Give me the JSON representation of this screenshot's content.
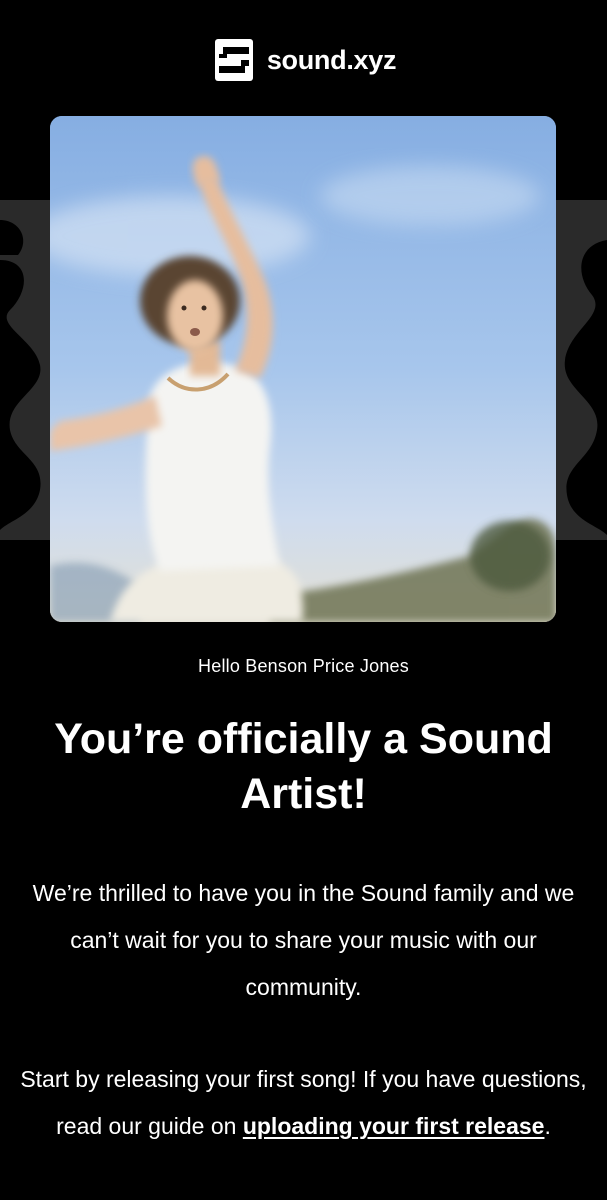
{
  "header": {
    "brand": "sound.xyz",
    "logo_icon": "sound-logo-icon"
  },
  "hero": {
    "image": "photo of young long-haired man in white tank top leaping against blue sky, motion blurred"
  },
  "content": {
    "greeting": "Hello Benson Price Jones",
    "headline": "You’re officially a Sound Artist!",
    "intro": "We’re thrilled to have you in the Sound family and we can’t wait for you to share your music with our community.",
    "cta_prefix": "Start by releasing your first song! If you have questions, read our guide on ",
    "cta_link": "uploading your first release",
    "cta_suffix": "."
  },
  "colors": {
    "background": "#000000",
    "text": "#ffffff",
    "decor": "#2b2b2b"
  }
}
